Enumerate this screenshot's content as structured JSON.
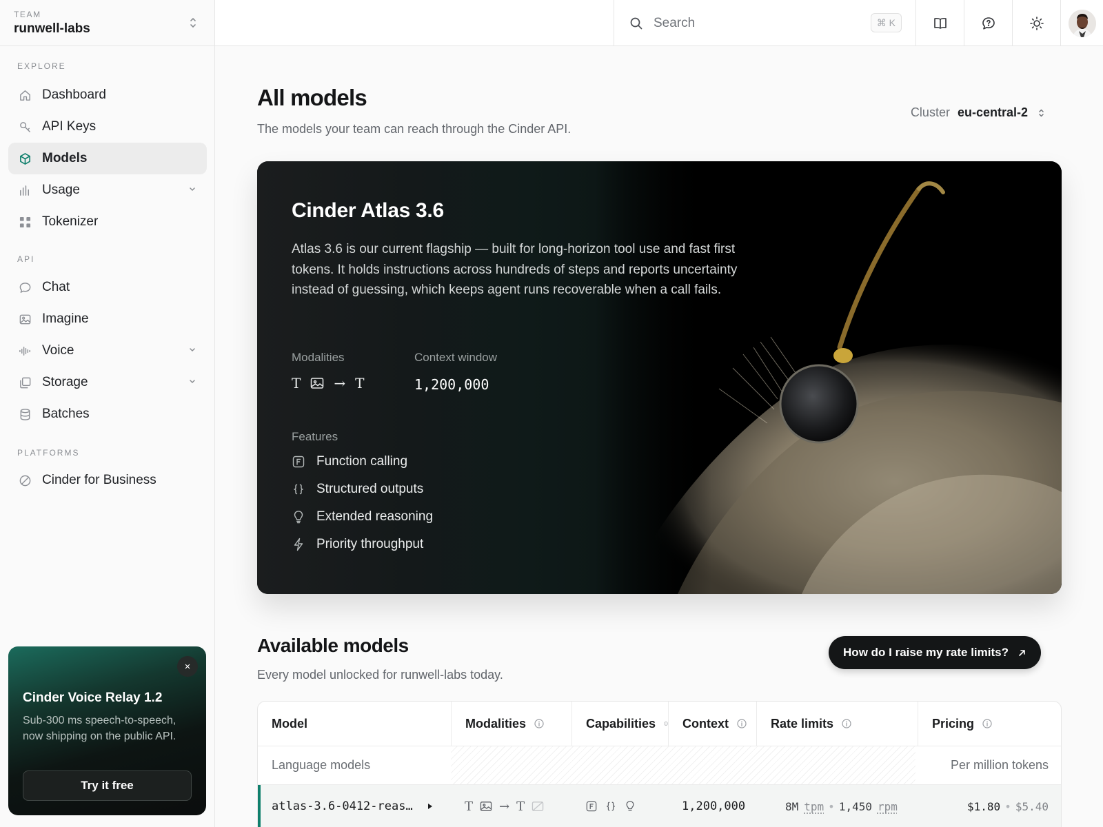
{
  "team": {
    "kicker": "TEAM",
    "name": "runwell-labs"
  },
  "sidebar": {
    "sections": [
      {
        "label": "EXPLORE"
      },
      {
        "label": "API"
      },
      {
        "label": "PLATFORMS"
      }
    ],
    "items": [
      {
        "label": "Dashboard",
        "icon": "home-icon"
      },
      {
        "label": "API Keys",
        "icon": "key-icon"
      },
      {
        "label": "Models",
        "icon": "cube-icon",
        "active": true
      },
      {
        "label": "Usage",
        "icon": "bar-chart-icon",
        "expandable": true
      },
      {
        "label": "Tokenizer",
        "icon": "grid-icon"
      },
      {
        "label": "Chat",
        "icon": "chat-icon"
      },
      {
        "label": "Imagine",
        "icon": "image-icon"
      },
      {
        "label": "Voice",
        "icon": "waveform-icon",
        "expandable": true
      },
      {
        "label": "Storage",
        "icon": "stack-icon",
        "expandable": true
      },
      {
        "label": "Batches",
        "icon": "database-icon"
      },
      {
        "label": "Cinder for Business",
        "icon": "slash-circle-icon"
      }
    ]
  },
  "promo": {
    "title": "Cinder Voice Relay 1.2",
    "text": "Sub-300 ms speech-to-speech, now shipping on the public API.",
    "button": "Try it free",
    "close": "×"
  },
  "topbar": {
    "search_placeholder": "Search",
    "shortcut": "⌘ K",
    "buttons": [
      "book-icon",
      "help-chat-icon",
      "sun-icon"
    ]
  },
  "page": {
    "title": "All models",
    "subtitle": "The models your team can reach through the Cinder API.",
    "cluster_label": "Cluster",
    "cluster_value": "eu-central-2"
  },
  "hero": {
    "title": "Cinder Atlas 3.6",
    "description": "Atlas 3.6 is our current flagship — built for long-horizon tool use and fast first tokens. It holds instructions across hundreds of steps and reports uncertainty instead of guessing, which keeps agent runs recoverable when a call fails.",
    "modalities_label": "Modalities",
    "modalities": {
      "input_text": "T",
      "arrow": "→",
      "output_text": "T"
    },
    "context_label": "Context window",
    "context_value": "1,200,000",
    "features_label": "Features",
    "features": [
      {
        "label": "Function calling",
        "icon": "function-icon"
      },
      {
        "label": "Structured outputs",
        "icon": "braces-icon"
      },
      {
        "label": "Extended reasoning",
        "icon": "lightbulb-icon"
      },
      {
        "label": "Priority throughput",
        "icon": "lightning-icon"
      }
    ]
  },
  "available": {
    "title": "Available models",
    "subtitle": "Every model unlocked for runwell-labs today.",
    "rate_button": "How do I raise my rate limits?"
  },
  "table": {
    "columns": [
      "Model",
      "Modalities",
      "Capabilities",
      "Context",
      "Rate limits",
      "Pricing"
    ],
    "group": {
      "label": "Language models",
      "unit": "Per million tokens"
    },
    "rows": [
      {
        "model": "atlas-3.6-0412-reas…",
        "modalities": {
          "input_text": "T",
          "arrow": "→",
          "output_text": "T"
        },
        "context": "1,200,000",
        "tpm_value": "8M",
        "tpm_unit": "tpm",
        "rpm_value": "1,450",
        "rpm_unit": "rpm",
        "price_in": "$1.80",
        "price_out": "$5.40",
        "separator": "•"
      }
    ]
  },
  "colors": {
    "accent": "#0f7f6c",
    "hero_bg": "#000000",
    "rate_button_bg": "#141617"
  }
}
